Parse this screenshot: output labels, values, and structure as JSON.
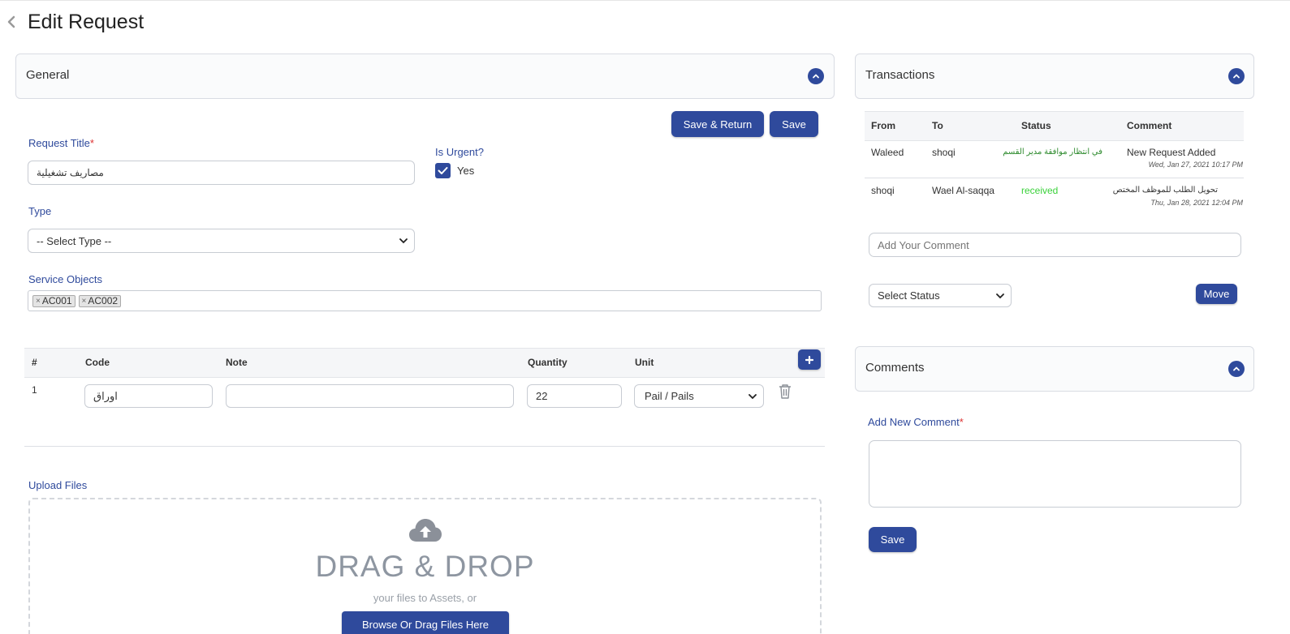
{
  "header": {
    "title": "Edit Request"
  },
  "general": {
    "panel_title": "General",
    "save_return_label": "Save & Return",
    "save_label": "Save",
    "request_title_label": "Request Title",
    "request_title_required": "*",
    "request_title_value": "مصاريف تشغيلية",
    "is_urgent_label": "Is Urgent?",
    "is_urgent_option": "Yes",
    "is_urgent_checked": true,
    "type_label": "Type",
    "type_selected": "-- Select Type --",
    "service_objects_label": "Service Objects",
    "service_objects": [
      "AC001",
      "AC002"
    ],
    "items_table": {
      "headers": [
        "#",
        "Code",
        "Note",
        "Quantity",
        "Unit"
      ],
      "rows": [
        {
          "index": "1",
          "code": "اوراق",
          "note": "",
          "quantity": "22",
          "unit": "Pail / Pails"
        }
      ]
    },
    "upload_label": "Upload Files",
    "drag_drop_title": "DRAG & DROP",
    "drag_drop_sub": "your files to Assets, or",
    "browse_label": "Browse Or Drag Files Here"
  },
  "transactions": {
    "panel_title": "Transactions",
    "headers": [
      "From",
      "To",
      "Status",
      "Comment"
    ],
    "rows": [
      {
        "from": "Waleed",
        "to": "shoqi",
        "status": "في انتظار موافقة مدير القسم",
        "status_color": "#2e8b2e",
        "comment": "New Request Added",
        "date": "Wed, Jan 27, 2021 10:17 PM"
      },
      {
        "from": "shoqi",
        "to": "Wael Al-saqqa",
        "status": "received",
        "status_color": "#3ad13a",
        "comment": "تحويل الطلب للموظف المختص",
        "date": "Thu, Jan 28, 2021 12:04 PM"
      }
    ],
    "comment_placeholder": "Add Your Comment",
    "status_selected": "Select Status",
    "move_label": "Move"
  },
  "comments": {
    "panel_title": "Comments",
    "add_label": "Add New Comment",
    "add_required": "*",
    "save_label": "Save"
  },
  "colors": {
    "accent": "#2f4a9c",
    "label": "#2f4a9c",
    "required": "#d33333"
  }
}
